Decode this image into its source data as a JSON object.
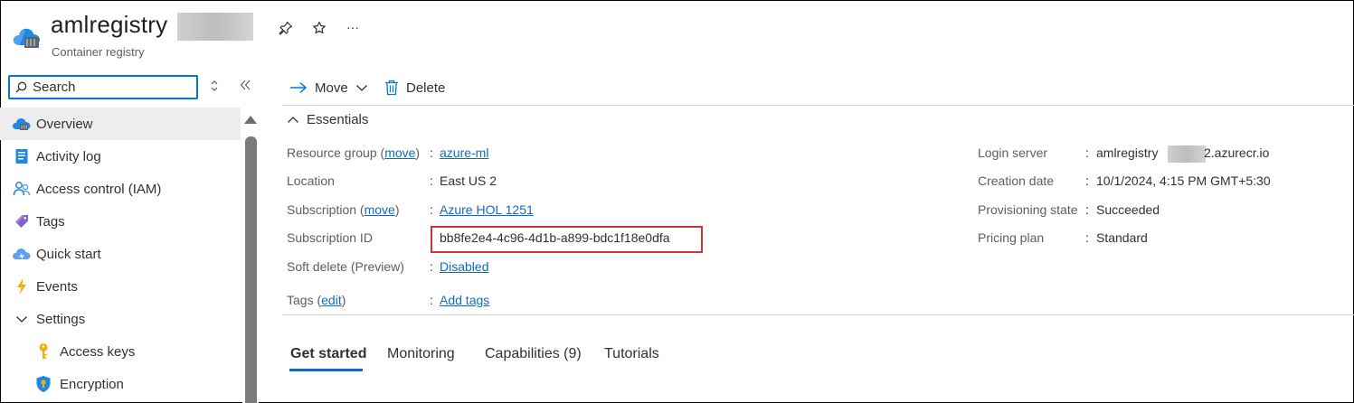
{
  "header": {
    "title": "amlregistry",
    "subtitle": "Container registry",
    "pin_icon": "pin-icon",
    "favorite_icon": "star-icon",
    "more_label": "···"
  },
  "sidebar": {
    "search_placeholder": "Search",
    "items": [
      {
        "label": "Overview",
        "icon": "overview-cloud-icon",
        "active": true
      },
      {
        "label": "Activity log",
        "icon": "activity-log-icon"
      },
      {
        "label": "Access control (IAM)",
        "icon": "iam-people-icon"
      },
      {
        "label": "Tags",
        "icon": "tag-icon"
      },
      {
        "label": "Quick start",
        "icon": "quick-start-cloud-icon"
      },
      {
        "label": "Events",
        "icon": "lightning-icon"
      },
      {
        "label": "Settings",
        "icon": "chevron-down-icon"
      },
      {
        "label": "Access keys",
        "icon": "key-icon",
        "sub": true
      },
      {
        "label": "Encryption",
        "icon": "shield-icon",
        "sub": true
      }
    ]
  },
  "toolbar": {
    "move_label": "Move",
    "delete_label": "Delete"
  },
  "essentials": {
    "title": "Essentials",
    "left": [
      {
        "label": "Resource group",
        "action": "move",
        "value": "azure-ml",
        "link": true
      },
      {
        "label": "Location",
        "value": "East US 2"
      },
      {
        "label": "Subscription",
        "action": "move",
        "value": "Azure HOL 1251",
        "link": true
      },
      {
        "label": "Subscription ID",
        "value": "bb8fe2e4-4c96-4d1b-a899-bdc1f18e0dfa"
      },
      {
        "label": "Soft delete (Preview)",
        "value": "Disabled",
        "link": true
      },
      {
        "label": "Tags",
        "action": "edit",
        "value": "Add tags",
        "link": true
      }
    ],
    "right": [
      {
        "label": "Login server",
        "value_prefix": "amlregistry",
        "value_suffix": "2.azurecr.io"
      },
      {
        "label": "Creation date",
        "value": "10/1/2024, 4:15 PM GMT+5:30"
      },
      {
        "label": "Provisioning state",
        "value": "Succeeded"
      },
      {
        "label": "Pricing plan",
        "value": "Standard"
      }
    ]
  },
  "tabs": [
    {
      "label": "Get started",
      "active": true
    },
    {
      "label": "Monitoring"
    },
    {
      "label": "Capabilities (9)"
    },
    {
      "label": "Tutorials"
    }
  ],
  "colors": {
    "accent": "#0078d4",
    "link": "#0f6cbd",
    "highlight": "#d13438"
  }
}
